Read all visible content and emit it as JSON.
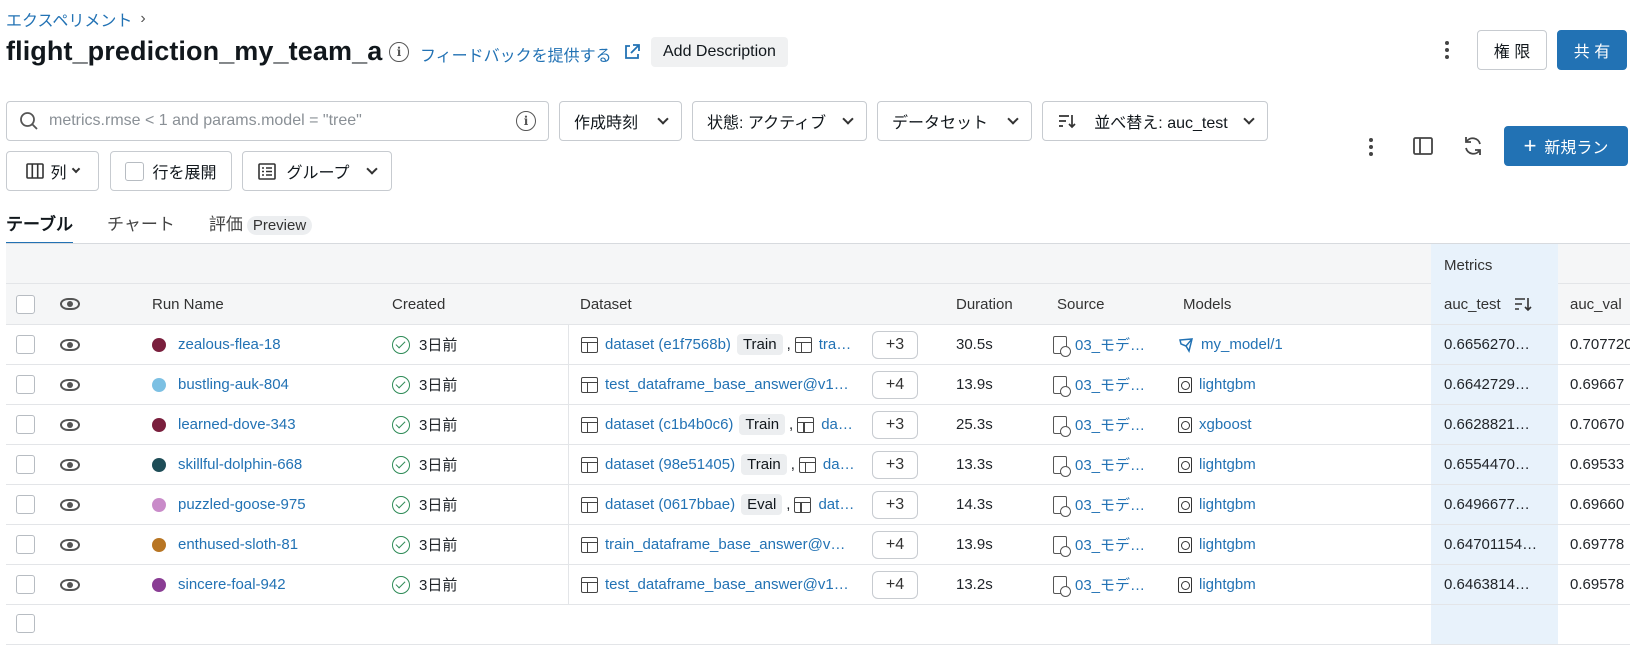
{
  "breadcrumb": {
    "parent": "エクスペリメント",
    "sep": "›"
  },
  "header": {
    "title": "flight_prediction_my_team_a",
    "feedback_link": "フィードバックを提供する",
    "add_description": "Add Description",
    "permissions_button": "権 限",
    "share_button": "共 有"
  },
  "toolbar": {
    "search_placeholder": "metrics.rmse < 1 and params.model = \"tree\"",
    "created_filter": "作成時刻",
    "state_filter": "状態: アクティブ",
    "dataset_filter": "データセット",
    "sort_filter": "並べ替え: auc_test",
    "columns_button": "列",
    "expand_rows": "行を展開",
    "group_button": "グループ",
    "new_run_button": "新規ラン"
  },
  "tabs": [
    {
      "label": "テーブル",
      "active": true
    },
    {
      "label": "チャート",
      "active": false
    },
    {
      "label": "評価",
      "badge": "Preview",
      "active": false
    }
  ],
  "table": {
    "group_header": "Metrics",
    "columns": {
      "run_name": "Run Name",
      "created": "Created",
      "dataset": "Dataset",
      "duration": "Duration",
      "source": "Source",
      "models": "Models",
      "auc_test": "auc_test",
      "auc_val": "auc_val"
    },
    "rows": [
      {
        "name": "zealous-flea-18",
        "color": "#7a1f3d",
        "created": "3日前",
        "dataset": "dataset (e1f7568b)",
        "tag": "Train",
        "second": "tra…",
        "more": "+3",
        "duration": "30.5s",
        "source": "03_モデ…",
        "model": "my_model/1",
        "model_icon": "registered-model-icon",
        "auc_test": "0.6656270…",
        "auc_val": "0.707720"
      },
      {
        "name": "bustling-auk-804",
        "color": "#7cc0e3",
        "created": "3日前",
        "dataset": "test_dataframe_base_answer@v1…",
        "tag": "",
        "second": "",
        "more": "+4",
        "duration": "13.9s",
        "source": "03_モデ…",
        "model": "lightgbm",
        "model_icon": "model-icon",
        "auc_test": "0.6642729…",
        "auc_val": "0.69667"
      },
      {
        "name": "learned-dove-343",
        "color": "#7a1f3d",
        "created": "3日前",
        "dataset": "dataset (c1b4b0c6)",
        "tag": "Train",
        "second": "da…",
        "more": "+3",
        "duration": "25.3s",
        "source": "03_モデ…",
        "model": "xgboost",
        "model_icon": "model-icon",
        "auc_test": "0.6628821…",
        "auc_val": "0.70670"
      },
      {
        "name": "skillful-dolphin-668",
        "color": "#1e4d57",
        "created": "3日前",
        "dataset": "dataset (98e51405)",
        "tag": "Train",
        "second": "da…",
        "more": "+3",
        "duration": "13.3s",
        "source": "03_モデ…",
        "model": "lightgbm",
        "model_icon": "model-icon",
        "auc_test": "0.6554470…",
        "auc_val": "0.69533"
      },
      {
        "name": "puzzled-goose-975",
        "color": "#c98bc9",
        "created": "3日前",
        "dataset": "dataset (0617bbae)",
        "tag": "Eval",
        "second": "dat…",
        "more": "+3",
        "duration": "14.3s",
        "source": "03_モデ…",
        "model": "lightgbm",
        "model_icon": "model-icon",
        "auc_test": "0.6496677…",
        "auc_val": "0.69660"
      },
      {
        "name": "enthused-sloth-81",
        "color": "#b87523",
        "created": "3日前",
        "dataset": "train_dataframe_base_answer@v…",
        "tag": "",
        "second": "",
        "more": "+4",
        "duration": "13.9s",
        "source": "03_モデ…",
        "model": "lightgbm",
        "model_icon": "model-icon",
        "auc_test": "0.64701154…",
        "auc_val": "0.69778"
      },
      {
        "name": "sincere-foal-942",
        "color": "#8a3d94",
        "created": "3日前",
        "dataset": "test_dataframe_base_answer@v1…",
        "tag": "",
        "second": "",
        "more": "+4",
        "duration": "13.2s",
        "source": "03_モデ…",
        "model": "lightgbm",
        "model_icon": "model-icon",
        "auc_test": "0.6463814…",
        "auc_val": "0.69578"
      }
    ]
  }
}
